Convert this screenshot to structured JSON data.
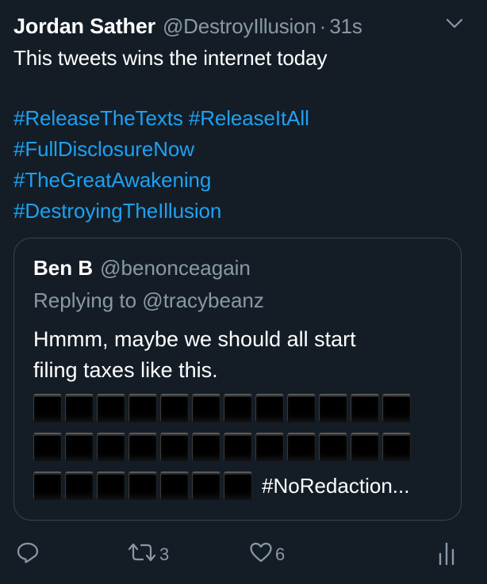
{
  "tweet": {
    "author_name": "Jordan Sather",
    "author_handle": "@DestroyIllusion",
    "separator": "·",
    "timestamp": "31s",
    "text": "This tweets wins the internet today",
    "hashtags": [
      "#ReleaseTheTexts #ReleaseItAll",
      "#FullDisclosureNow",
      "#TheGreatAwakening",
      "#DestroyingTheIllusion"
    ],
    "icons": {
      "menu": "chevron-down-icon",
      "reply": "reply-icon",
      "retweet": "retweet-icon",
      "like": "heart-icon",
      "analytics": "analytics-icon"
    }
  },
  "quoted_tweet": {
    "author_name": "Ben B",
    "author_handle": "@benonceagain",
    "replying_to": "Replying to @tracybeanz",
    "text_line1": "Hmmm, maybe we should all start",
    "text_line2": "filing taxes like this.",
    "block_rows": [
      12,
      12,
      7
    ],
    "block_emoji": "black-square-emoji",
    "trailing_text": "#NoRedaction..."
  },
  "actions": {
    "retweet_count": "3",
    "like_count": "6"
  },
  "colors": {
    "background": "#141d26",
    "text": "#ffffff",
    "muted": "#8899a6",
    "link": "#1da1f2",
    "border": "#38444d"
  }
}
